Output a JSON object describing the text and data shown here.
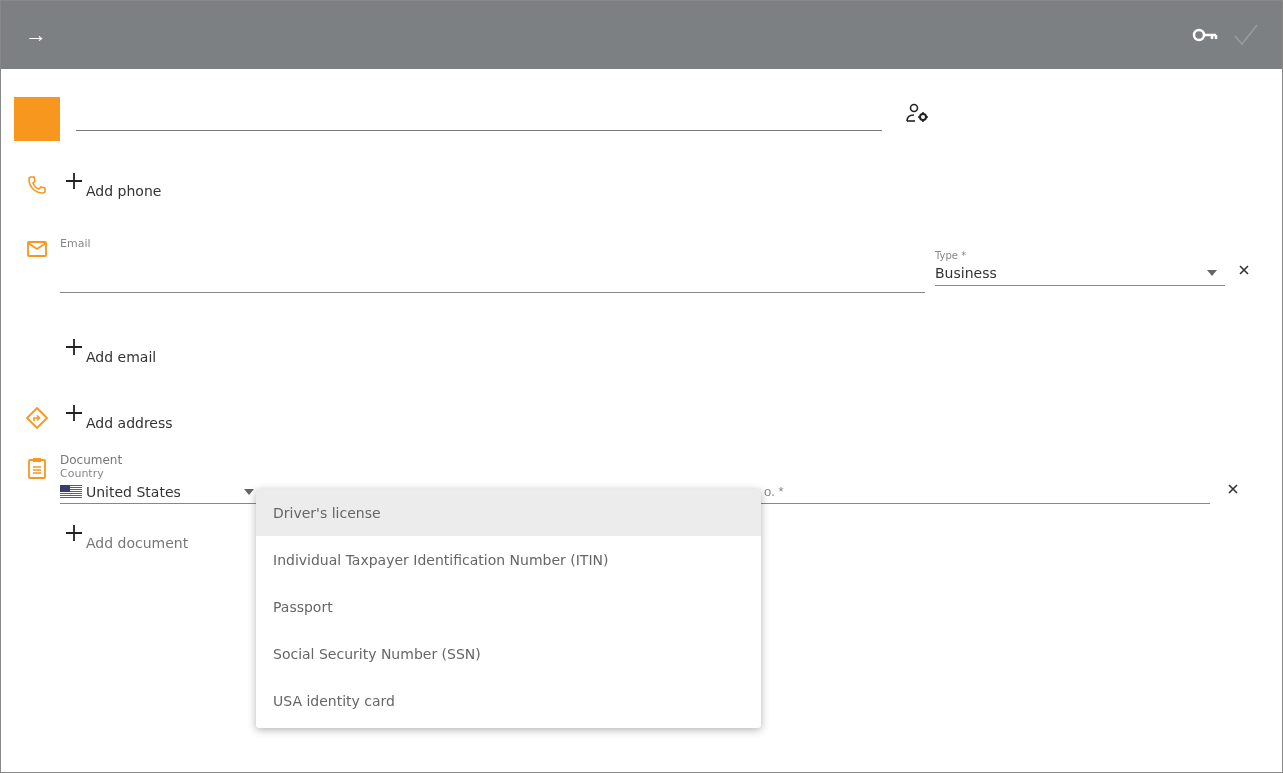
{
  "header": {
    "back": "→"
  },
  "phone": {
    "add_label": "Add phone"
  },
  "email": {
    "label": "Email",
    "type_label": "Type *",
    "type_value": "Business",
    "add_label": "Add email"
  },
  "address": {
    "add_label": "Add address"
  },
  "document": {
    "section_label": "Document",
    "country_label": "Country",
    "country_value": "United States",
    "number_placeholder": "o. *",
    "add_label": "Add document"
  },
  "type_menu": {
    "items": [
      {
        "label": "Driver's license",
        "selected": true
      },
      {
        "label": "Individual Taxpayer Identification Number (ITIN)",
        "selected": false
      },
      {
        "label": "Passport",
        "selected": false
      },
      {
        "label": "Social Security Number (SSN)",
        "selected": false
      },
      {
        "label": "USA identity card",
        "selected": false
      }
    ]
  }
}
